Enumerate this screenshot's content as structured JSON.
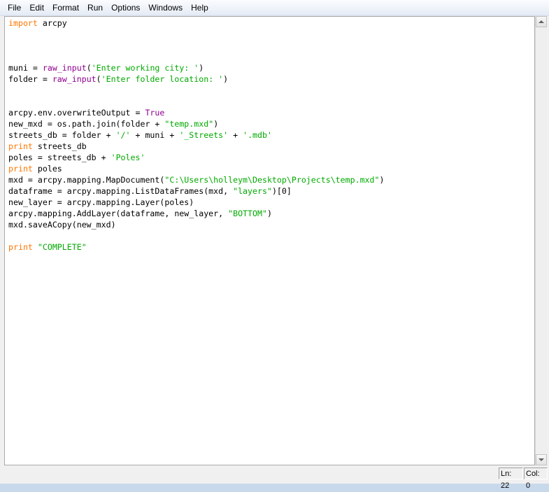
{
  "menu": [
    "File",
    "Edit",
    "Format",
    "Run",
    "Options",
    "Windows",
    "Help"
  ],
  "editor": {
    "lines": [
      [
        {
          "t": "import",
          "c": "kw"
        },
        {
          "t": " arcpy"
        }
      ],
      [],
      [],
      [],
      [
        {
          "t": "muni = "
        },
        {
          "t": "raw_input",
          "c": "bi"
        },
        {
          "t": "("
        },
        {
          "t": "'Enter working city: '",
          "c": "str"
        },
        {
          "t": ")"
        }
      ],
      [
        {
          "t": "folder = "
        },
        {
          "t": "raw_input",
          "c": "bi"
        },
        {
          "t": "("
        },
        {
          "t": "'Enter folder location: '",
          "c": "str"
        },
        {
          "t": ")"
        }
      ],
      [],
      [],
      [
        {
          "t": "arcpy.env.overwriteOutput = "
        },
        {
          "t": "True",
          "c": "bi"
        }
      ],
      [
        {
          "t": "new_mxd = os.path.join(folder + "
        },
        {
          "t": "\"temp.mxd\"",
          "c": "str"
        },
        {
          "t": ")"
        }
      ],
      [
        {
          "t": "streets_db = folder + "
        },
        {
          "t": "'/'",
          "c": "str"
        },
        {
          "t": " + muni + "
        },
        {
          "t": "'_Streets'",
          "c": "str"
        },
        {
          "t": " + "
        },
        {
          "t": "'.mdb'",
          "c": "str"
        }
      ],
      [
        {
          "t": "print",
          "c": "kw"
        },
        {
          "t": " streets_db"
        }
      ],
      [
        {
          "t": "poles = streets_db + "
        },
        {
          "t": "'Poles'",
          "c": "str"
        }
      ],
      [
        {
          "t": "print",
          "c": "kw"
        },
        {
          "t": " poles"
        }
      ],
      [
        {
          "t": "mxd = arcpy.mapping.MapDocument("
        },
        {
          "t": "\"C:\\Users\\holleym\\Desktop\\Projects\\temp.mxd\"",
          "c": "str"
        },
        {
          "t": ")"
        }
      ],
      [
        {
          "t": "dataframe = arcpy.mapping.ListDataFrames(mxd, "
        },
        {
          "t": "\"layers\"",
          "c": "str"
        },
        {
          "t": ")[0]"
        }
      ],
      [
        {
          "t": "new_layer = arcpy.mapping.Layer(poles)"
        }
      ],
      [
        {
          "t": "arcpy.mapping.AddLayer(dataframe, new_layer, "
        },
        {
          "t": "\"BOTTOM\"",
          "c": "str"
        },
        {
          "t": ")"
        }
      ],
      [
        {
          "t": "mxd.saveACopy(new_mxd)"
        }
      ],
      [],
      [
        {
          "t": "print",
          "c": "kw"
        },
        {
          "t": " "
        },
        {
          "t": "\"COMPLETE\"",
          "c": "str"
        }
      ]
    ]
  },
  "status": {
    "line": "Ln: 22",
    "col": "Col: 0"
  },
  "colors": {
    "keyword": "#ff7700",
    "builtin": "#900090",
    "string": "#00aa00"
  }
}
